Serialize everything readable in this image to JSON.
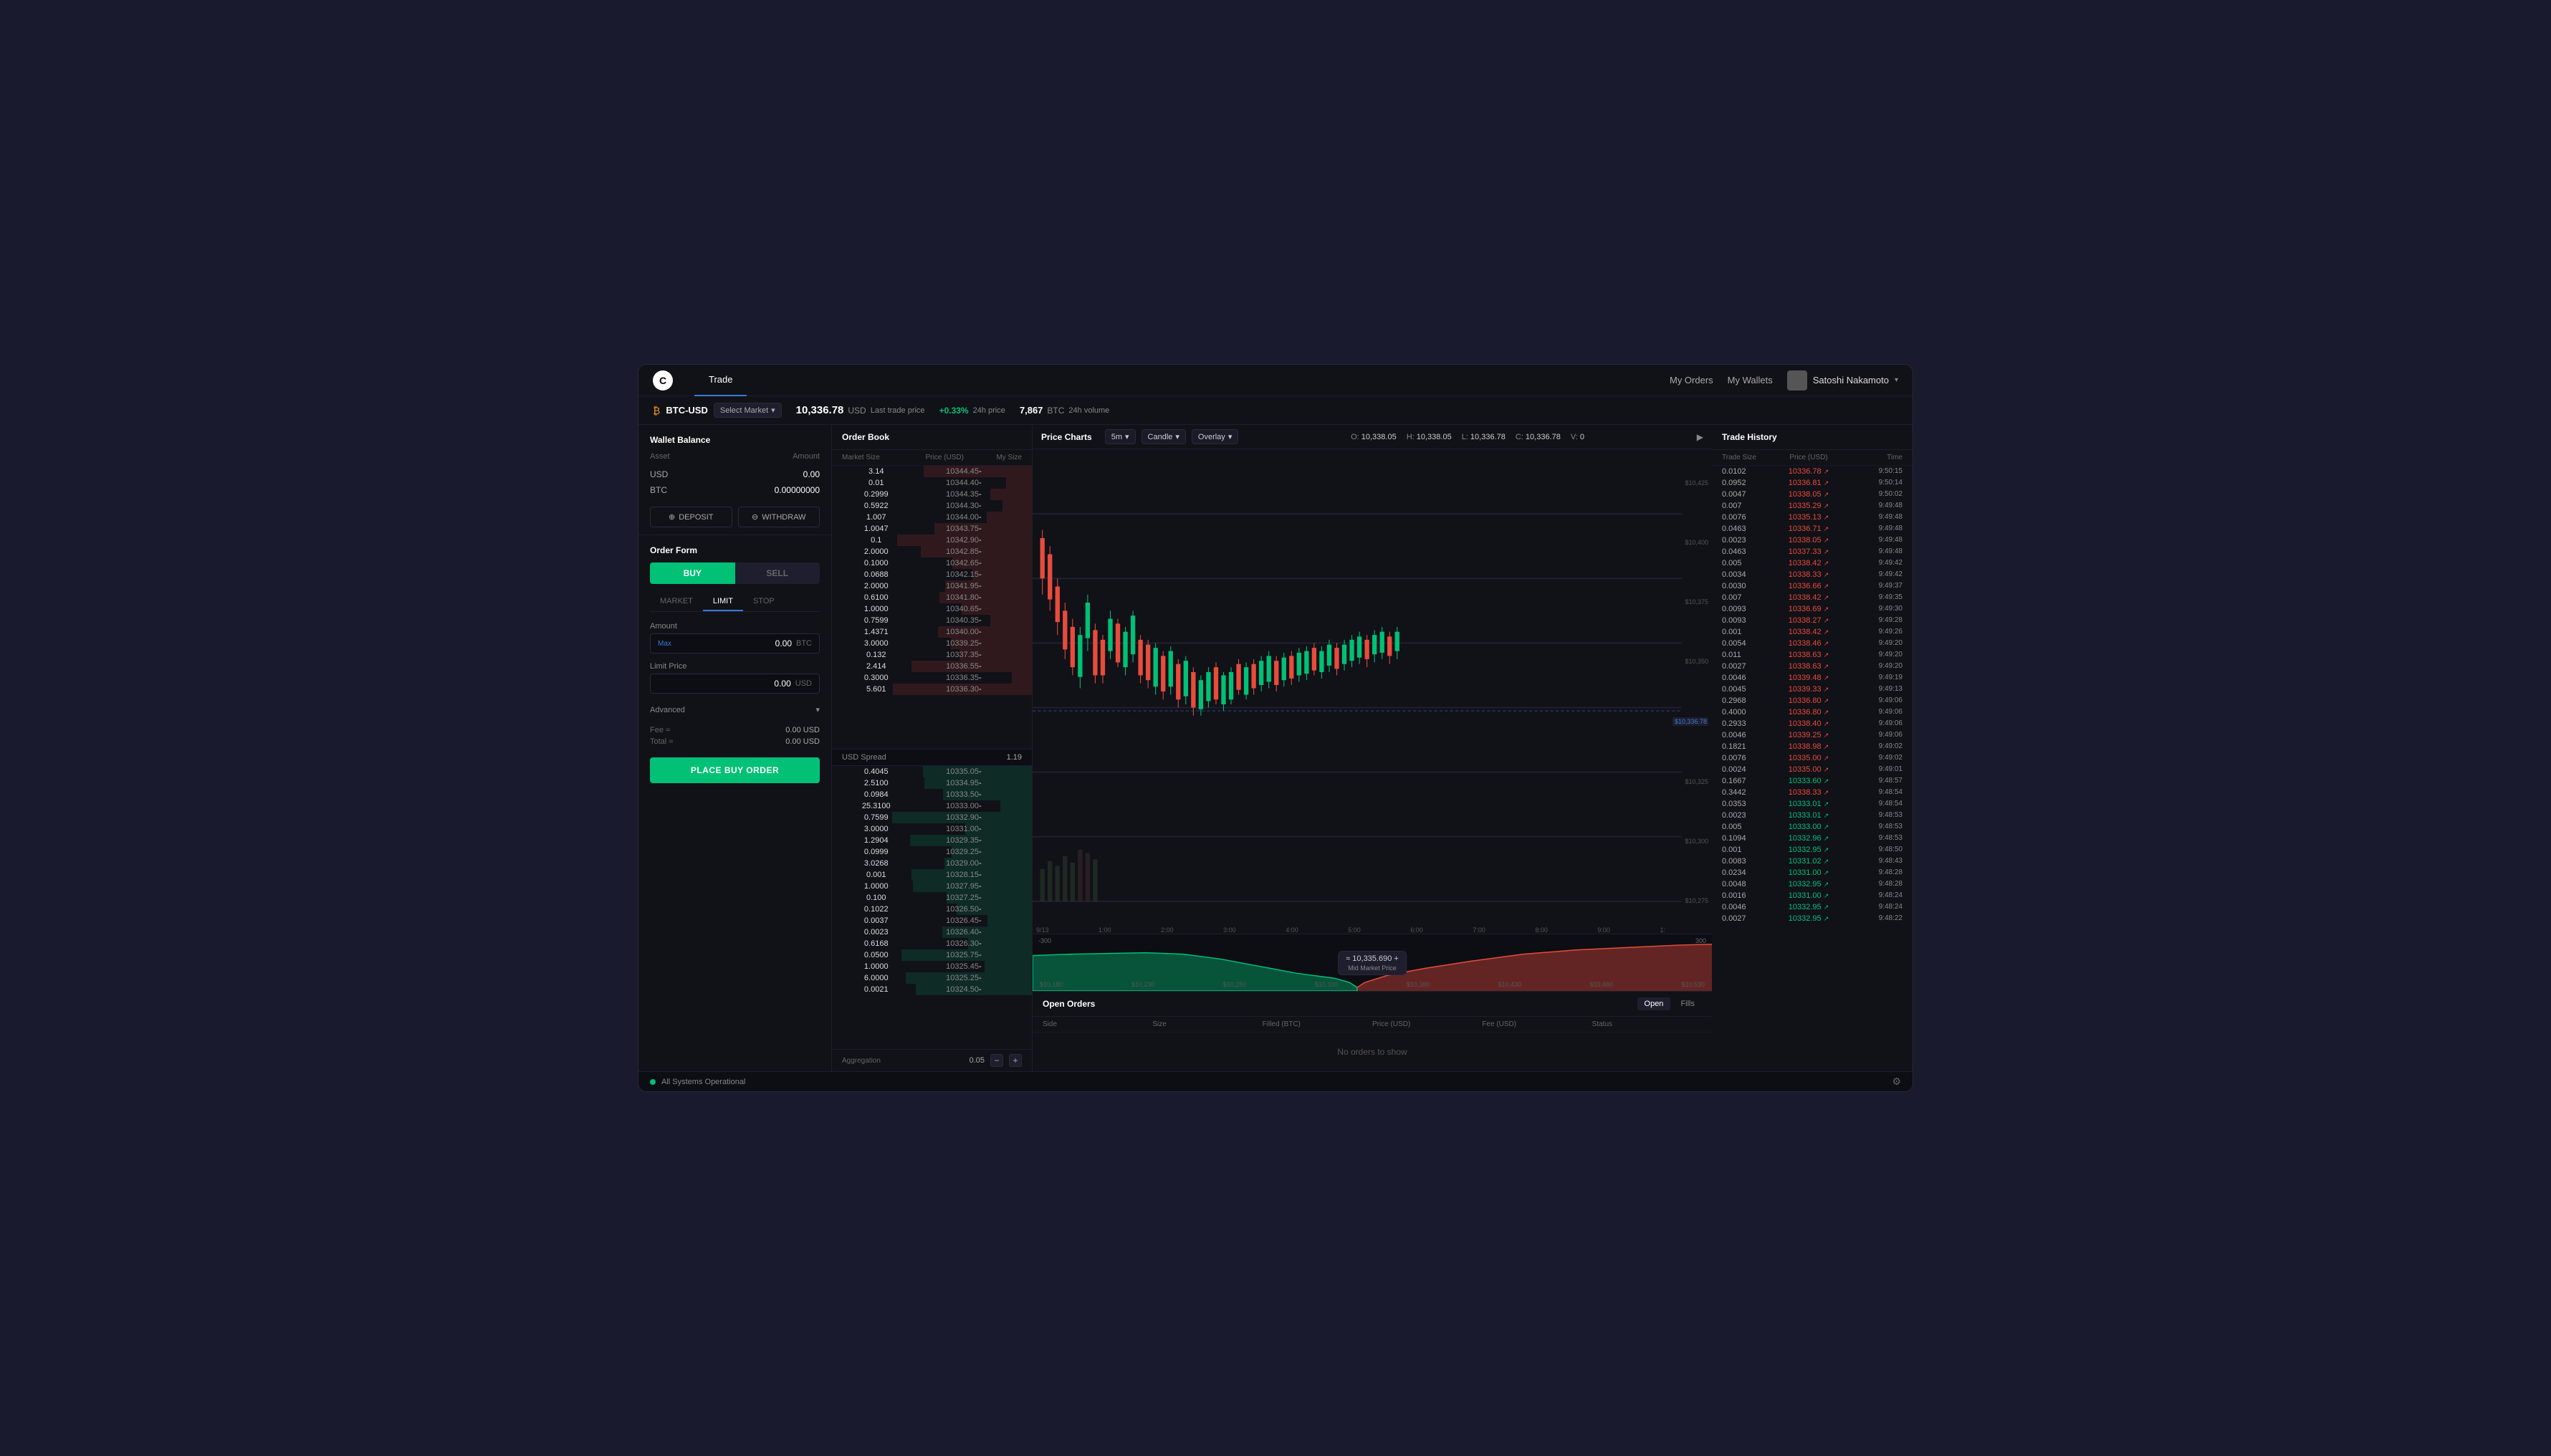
{
  "app": {
    "logo": "C",
    "nav_tabs": [
      {
        "label": "Trade",
        "active": true
      }
    ],
    "nav_links": [
      {
        "label": "My Orders",
        "id": "my-orders"
      },
      {
        "label": "My Wallets",
        "id": "my-wallets"
      }
    ],
    "user": {
      "name": "Satoshi Nakamoto"
    }
  },
  "price_bar": {
    "pair": "BTC-USD",
    "select_market": "Select Market",
    "last_price": "10,336.78",
    "currency": "USD",
    "last_price_label": "Last trade price",
    "change_24h": "+0.33%",
    "change_label": "24h price",
    "volume": "7,867",
    "volume_currency": "BTC",
    "volume_label": "24h volume"
  },
  "wallet": {
    "title": "Wallet Balance",
    "asset_label": "Asset",
    "amount_label": "Amount",
    "assets": [
      {
        "name": "USD",
        "amount": "0.00"
      },
      {
        "name": "BTC",
        "amount": "0.00000000"
      }
    ],
    "deposit_btn": "DEPOSIT",
    "withdraw_btn": "WITHDRAW"
  },
  "order_form": {
    "title": "Order Form",
    "buy_label": "BUY",
    "sell_label": "SELL",
    "order_types": [
      "MARKET",
      "LIMIT",
      "STOP"
    ],
    "active_type": "LIMIT",
    "amount_label": "Amount",
    "max_label": "Max",
    "amount_value": "0.00",
    "amount_unit": "BTC",
    "limit_price_label": "Limit Price",
    "limit_value": "0.00",
    "limit_unit": "USD",
    "advanced_label": "Advanced",
    "fee_label": "Fee ≈",
    "fee_value": "0.00 USD",
    "total_label": "Total ≈",
    "total_value": "0.00 USD",
    "place_order_btn": "PLACE BUY ORDER"
  },
  "order_book": {
    "title": "Order Book",
    "columns": [
      "Market Size",
      "Price (USD)",
      "My Size"
    ],
    "sell_orders": [
      {
        "size": "3.14",
        "price": "10344.45",
        "my_size": "-"
      },
      {
        "size": "0.01",
        "price": "10344.40",
        "my_size": "-"
      },
      {
        "size": "0.2999",
        "price": "10344.35",
        "my_size": "-"
      },
      {
        "size": "0.5922",
        "price": "10344.30",
        "my_size": "-"
      },
      {
        "size": "1.007",
        "price": "10344.00",
        "my_size": "-"
      },
      {
        "size": "1.0047",
        "price": "10343.75",
        "my_size": "-"
      },
      {
        "size": "0.1",
        "price": "10342.90",
        "my_size": "-"
      },
      {
        "size": "2.0000",
        "price": "10342.85",
        "my_size": "-"
      },
      {
        "size": "0.1000",
        "price": "10342.65",
        "my_size": "-"
      },
      {
        "size": "0.0688",
        "price": "10342.15",
        "my_size": "-"
      },
      {
        "size": "2.0000",
        "price": "10341.95",
        "my_size": "-"
      },
      {
        "size": "0.6100",
        "price": "10341.80",
        "my_size": "-"
      },
      {
        "size": "1.0000",
        "price": "10340.65",
        "my_size": "-"
      },
      {
        "size": "0.7599",
        "price": "10340.35",
        "my_size": "-"
      },
      {
        "size": "1.4371",
        "price": "10340.00",
        "my_size": "-"
      },
      {
        "size": "3.0000",
        "price": "10339.25",
        "my_size": "-"
      },
      {
        "size": "0.132",
        "price": "10337.35",
        "my_size": "-"
      },
      {
        "size": "2.414",
        "price": "10336.55",
        "my_size": "-"
      },
      {
        "size": "0.3000",
        "price": "10336.35",
        "my_size": "-"
      },
      {
        "size": "5.601",
        "price": "10336.30",
        "my_size": "-"
      }
    ],
    "spread_label": "USD Spread",
    "spread_value": "1.19",
    "buy_orders": [
      {
        "size": "0.4045",
        "price": "10335.05",
        "my_size": "-"
      },
      {
        "size": "2.5100",
        "price": "10334.95",
        "my_size": "-"
      },
      {
        "size": "0.0984",
        "price": "10333.50",
        "my_size": "-"
      },
      {
        "size": "25.3100",
        "price": "10333.00",
        "my_size": "-"
      },
      {
        "size": "0.7599",
        "price": "10332.90",
        "my_size": "-"
      },
      {
        "size": "3.0000",
        "price": "10331.00",
        "my_size": "-"
      },
      {
        "size": "1.2904",
        "price": "10329.35",
        "my_size": "-"
      },
      {
        "size": "0.0999",
        "price": "10329.25",
        "my_size": "-"
      },
      {
        "size": "3.0268",
        "price": "10329.00",
        "my_size": "-"
      },
      {
        "size": "0.001",
        "price": "10328.15",
        "my_size": "-"
      },
      {
        "size": "1.0000",
        "price": "10327.95",
        "my_size": "-"
      },
      {
        "size": "0.100",
        "price": "10327.25",
        "my_size": "-"
      },
      {
        "size": "0.1022",
        "price": "10326.50",
        "my_size": "-"
      },
      {
        "size": "0.0037",
        "price": "10326.45",
        "my_size": "-"
      },
      {
        "size": "0.0023",
        "price": "10326.40",
        "my_size": "-"
      },
      {
        "size": "0.6168",
        "price": "10326.30",
        "my_size": "-"
      },
      {
        "size": "0.0500",
        "price": "10325.75",
        "my_size": "-"
      },
      {
        "size": "1.0000",
        "price": "10325.45",
        "my_size": "-"
      },
      {
        "size": "6.0000",
        "price": "10325.25",
        "my_size": "-"
      },
      {
        "size": "0.0021",
        "price": "10324.50",
        "my_size": "-"
      }
    ],
    "aggregation_label": "Aggregation",
    "aggregation_value": "0.05"
  },
  "price_charts": {
    "title": "Price Charts",
    "timeframe": "5m",
    "chart_type": "Candle",
    "overlay": "Overlay",
    "ohlcv": {
      "o_label": "O:",
      "o_value": "10,338.05",
      "h_label": "H:",
      "h_value": "10,338.05",
      "l_label": "L:",
      "l_value": "10,336.78",
      "c_label": "C:",
      "c_value": "10,336.78",
      "v_label": "V:",
      "v_value": "0"
    },
    "price_levels": [
      "$10,425",
      "$10,400",
      "$10,375",
      "$10,350",
      "$10,325",
      "$10,300",
      "$10,275"
    ],
    "current_price": "$10,336.78",
    "time_labels": [
      "9/13",
      "1:00",
      "2:00",
      "3:00",
      "4:00",
      "5:00",
      "6:00",
      "7:00",
      "8:00",
      "9:00",
      "1:"
    ],
    "depth_labels": [
      "-300",
      "300"
    ],
    "depth_prices": [
      "$10,180",
      "$10,230",
      "$10,280",
      "$10,330",
      "$10,380",
      "$10,430",
      "$10,480",
      "$10,530"
    ],
    "mid_price": "≈ 10,335.690 +",
    "mid_price_sub": "Mid Market Price"
  },
  "open_orders": {
    "title": "Open Orders",
    "tabs": [
      {
        "label": "Open",
        "active": true
      },
      {
        "label": "Fills",
        "active": false
      }
    ],
    "columns": [
      "Side",
      "Size",
      "Filled (BTC)",
      "Price (USD)",
      "Fee (USD)",
      "Status"
    ],
    "empty_message": "No orders to show"
  },
  "trade_history": {
    "title": "Trade History",
    "columns": [
      "Trade Size",
      "Price (USD)",
      "Time"
    ],
    "rows": [
      {
        "size": "0.0102",
        "price": "10336.78",
        "dir": "up",
        "time": "9:50:15"
      },
      {
        "size": "0.0952",
        "price": "10336.81",
        "dir": "up",
        "time": "9:50:14"
      },
      {
        "size": "0.0047",
        "price": "10338.05",
        "dir": "up",
        "time": "9:50:02"
      },
      {
        "size": "0.007",
        "price": "10335.29",
        "dir": "up",
        "time": "9:49:48"
      },
      {
        "size": "0.0076",
        "price": "10335.13",
        "dir": "up",
        "time": "9:49:48"
      },
      {
        "size": "0.0463",
        "price": "10336.71",
        "dir": "up",
        "time": "9:49:48"
      },
      {
        "size": "0.0023",
        "price": "10338.05",
        "dir": "up",
        "time": "9:49:48"
      },
      {
        "size": "0.0463",
        "price": "10337.33",
        "dir": "up",
        "time": "9:49:48"
      },
      {
        "size": "0.005",
        "price": "10338.42",
        "dir": "up",
        "time": "9:49:42"
      },
      {
        "size": "0.0034",
        "price": "10338.33",
        "dir": "up",
        "time": "9:49:42"
      },
      {
        "size": "0.0030",
        "price": "10336.66",
        "dir": "up",
        "time": "9:49:37"
      },
      {
        "size": "0.007",
        "price": "10338.42",
        "dir": "up",
        "time": "9:49:35"
      },
      {
        "size": "0.0093",
        "price": "10336.69",
        "dir": "up",
        "time": "9:49:30"
      },
      {
        "size": "0.0093",
        "price": "10338.27",
        "dir": "up",
        "time": "9:49:28"
      },
      {
        "size": "0.001",
        "price": "10338.42",
        "dir": "up",
        "time": "9:49:26"
      },
      {
        "size": "0.0054",
        "price": "10338.46",
        "dir": "up",
        "time": "9:49:20"
      },
      {
        "size": "0.011",
        "price": "10338.63",
        "dir": "up",
        "time": "9:49:20"
      },
      {
        "size": "0.0027",
        "price": "10338.63",
        "dir": "up",
        "time": "9:49:20"
      },
      {
        "size": "0.0046",
        "price": "10339.48",
        "dir": "up",
        "time": "9:49:19"
      },
      {
        "size": "0.0045",
        "price": "10339.33",
        "dir": "up",
        "time": "9:49:13"
      },
      {
        "size": "0.2968",
        "price": "10336.80",
        "dir": "up",
        "time": "9:49:06"
      },
      {
        "size": "0.4000",
        "price": "10336.80",
        "dir": "up",
        "time": "9:49:06"
      },
      {
        "size": "0.2933",
        "price": "10338.40",
        "dir": "up",
        "time": "9:49:06"
      },
      {
        "size": "0.0046",
        "price": "10339.25",
        "dir": "up",
        "time": "9:49:06"
      },
      {
        "size": "0.1821",
        "price": "10338.98",
        "dir": "up",
        "time": "9:49:02"
      },
      {
        "size": "0.0076",
        "price": "10335.00",
        "dir": "up",
        "time": "9:49:02"
      },
      {
        "size": "0.0024",
        "price": "10335.00",
        "dir": "up",
        "time": "9:49:01"
      },
      {
        "size": "0.1667",
        "price": "10333.60",
        "dir": "down",
        "time": "9:48:57"
      },
      {
        "size": "0.3442",
        "price": "10338.33",
        "dir": "up",
        "time": "9:48:54"
      },
      {
        "size": "0.0353",
        "price": "10333.01",
        "dir": "down",
        "time": "9:48:54"
      },
      {
        "size": "0.0023",
        "price": "10333.01",
        "dir": "down",
        "time": "9:48:53"
      },
      {
        "size": "0.005",
        "price": "10333.00",
        "dir": "down",
        "time": "9:48:53"
      },
      {
        "size": "0.1094",
        "price": "10332.96",
        "dir": "down",
        "time": "9:48:53"
      },
      {
        "size": "0.001",
        "price": "10332.95",
        "dir": "down",
        "time": "9:48:50"
      },
      {
        "size": "0.0083",
        "price": "10331.02",
        "dir": "down",
        "time": "9:48:43"
      },
      {
        "size": "0.0234",
        "price": "10331.00",
        "dir": "down",
        "time": "9:48:28"
      },
      {
        "size": "0.0048",
        "price": "10332.95",
        "dir": "down",
        "time": "9:48:28"
      },
      {
        "size": "0.0016",
        "price": "10331.00",
        "dir": "down",
        "time": "9:48:24"
      },
      {
        "size": "0.0046",
        "price": "10332.95",
        "dir": "down",
        "time": "9:48:24"
      },
      {
        "size": "0.0027",
        "price": "10332.95",
        "dir": "down",
        "time": "9:48:22"
      }
    ]
  },
  "status_bar": {
    "status": "All Systems Operational",
    "indicator_color": "#00c176"
  }
}
